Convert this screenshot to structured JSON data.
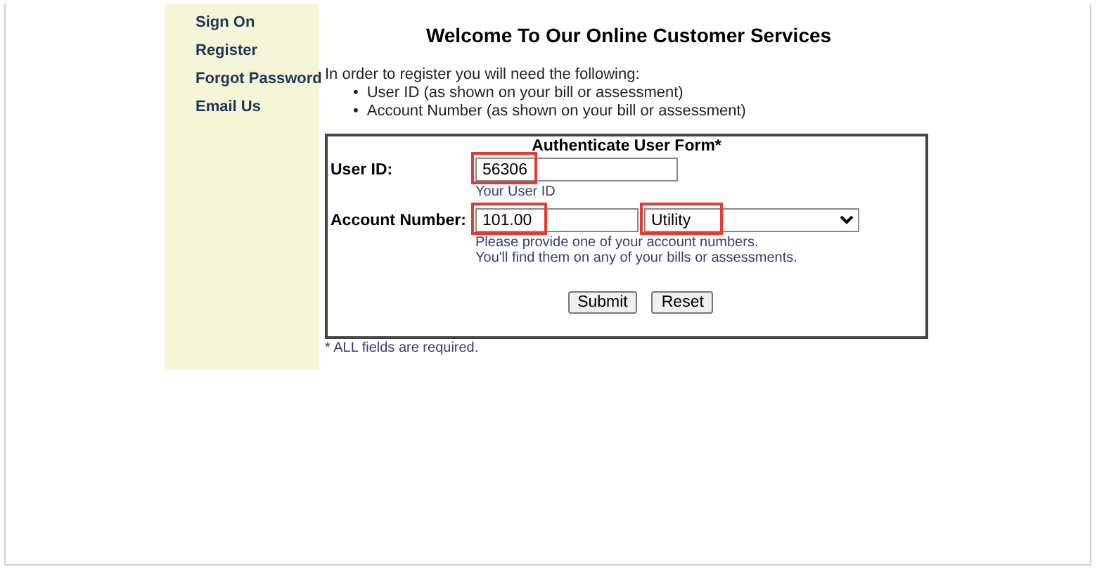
{
  "sidebar": {
    "items": [
      {
        "label": "Sign On"
      },
      {
        "label": "Register"
      },
      {
        "label": "Forgot Password"
      },
      {
        "label": "Email Us"
      }
    ]
  },
  "heading": "Welcome To Our Online Customer Services",
  "intro": "In order to register you will need the following:",
  "requirements": [
    {
      "marker": "•",
      "text": "User ID (as shown on your bill or assessment)"
    },
    {
      "marker": "•",
      "text": "Account Number (as shown on your bill or assessment)"
    }
  ],
  "form": {
    "title": "Authenticate User Form*",
    "rows": [
      {
        "label": "User ID:",
        "value": "56306",
        "highlighted": true,
        "hints": [
          "Your User ID"
        ]
      },
      {
        "label": "Account Number:",
        "value": "101.00",
        "highlighted": true,
        "select": {
          "value": "Utility",
          "highlighted": true
        },
        "hints": [
          "Please provide one of your account numbers.",
          "You'll find them on any of your bills or assessments."
        ]
      }
    ],
    "buttons": [
      "Submit",
      "Reset"
    ]
  },
  "footnote": "* ALL fields are required."
}
